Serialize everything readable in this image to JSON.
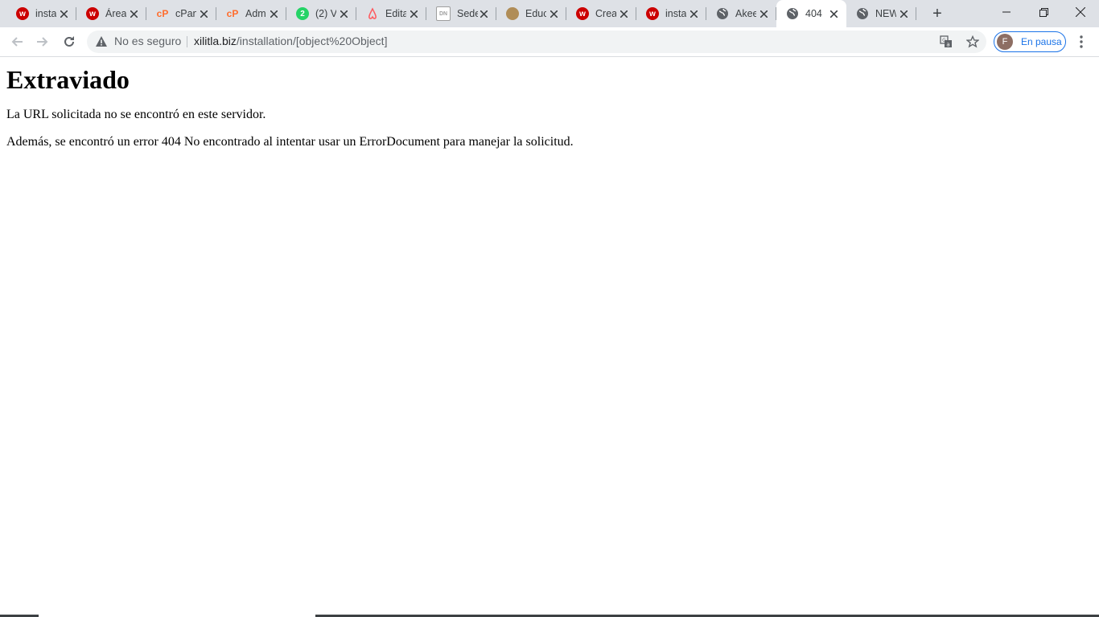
{
  "browser": {
    "tabs": [
      {
        "title": "insta",
        "favicon": "w-logo-icon",
        "color": "#cc0000",
        "active": false
      },
      {
        "title": "Área",
        "favicon": "w-logo-icon",
        "color": "#cc0000",
        "active": false
      },
      {
        "title": "cPan",
        "favicon": "cpanel-icon",
        "color": "#ff6c2c",
        "active": false
      },
      {
        "title": "Adm",
        "favicon": "cpanel-icon",
        "color": "#ff6c2c",
        "active": false
      },
      {
        "title": "(2) V",
        "favicon": "whatsapp-icon",
        "color": "#25d366",
        "active": false
      },
      {
        "title": "Edita",
        "favicon": "airbnb-icon",
        "color": "#ff5a5f",
        "active": false
      },
      {
        "title": "Sede",
        "favicon": "dn-logo-icon",
        "color": "#9e9e9e",
        "active": false
      },
      {
        "title": "Educ",
        "favicon": "circle-icon",
        "color": "#b08d57",
        "active": false
      },
      {
        "title": "Crea",
        "favicon": "w-logo-icon",
        "color": "#cc0000",
        "active": false
      },
      {
        "title": "insta",
        "favicon": "w-logo-icon",
        "color": "#cc0000",
        "active": false
      },
      {
        "title": "Akee",
        "favicon": "globe-icon",
        "color": "#5f6368",
        "active": false
      },
      {
        "title": "404",
        "favicon": "globe-icon",
        "color": "#5f6368",
        "active": true
      },
      {
        "title": "NEW",
        "favicon": "globe-icon",
        "color": "#5f6368",
        "active": false
      }
    ],
    "omnibox": {
      "security_text": "No es seguro",
      "url_host": "xilitla.biz",
      "url_path": "/installation/[object%20Object]"
    },
    "profile": {
      "initial": "F",
      "status": "En pausa"
    }
  },
  "page": {
    "heading": "Extraviado",
    "paragraph1": "La URL solicitada no se encontró en este servidor.",
    "paragraph2": "Además, se encontró un error 404 No encontrado al intentar usar un ErrorDocument para manejar la solicitud."
  }
}
